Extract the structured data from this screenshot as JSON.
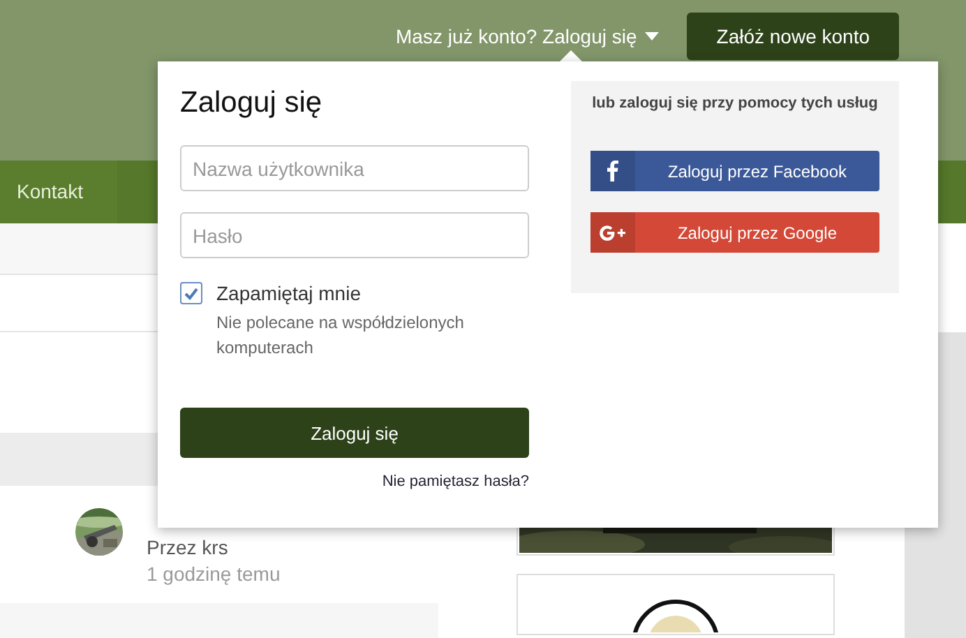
{
  "header": {
    "login_prompt": "Masz już konto? Zaloguj się",
    "register_button": "Załóż nowe konto"
  },
  "nav": {
    "items": [
      {
        "label": "Kontakt"
      }
    ]
  },
  "feed": {
    "post": {
      "author": "Przez krs",
      "time": "1 godzinę temu"
    }
  },
  "login_popup": {
    "title": "Zaloguj się",
    "username": {
      "placeholder": "Nazwa użytkownika"
    },
    "password": {
      "placeholder": "Hasło"
    },
    "remember": {
      "label": "Zapamiętaj mnie",
      "checked": true,
      "hint": "Nie polecane na współdzielonych komputerach"
    },
    "submit": "Zaloguj się",
    "forgot": "Nie pamiętasz hasła?",
    "social": {
      "heading": "lub zaloguj się przy pomocy tych usług",
      "buttons": [
        {
          "kind": "facebook",
          "label": "Zaloguj przez Facebook"
        },
        {
          "kind": "google",
          "label": "Zaloguj przez Google"
        }
      ]
    }
  }
}
